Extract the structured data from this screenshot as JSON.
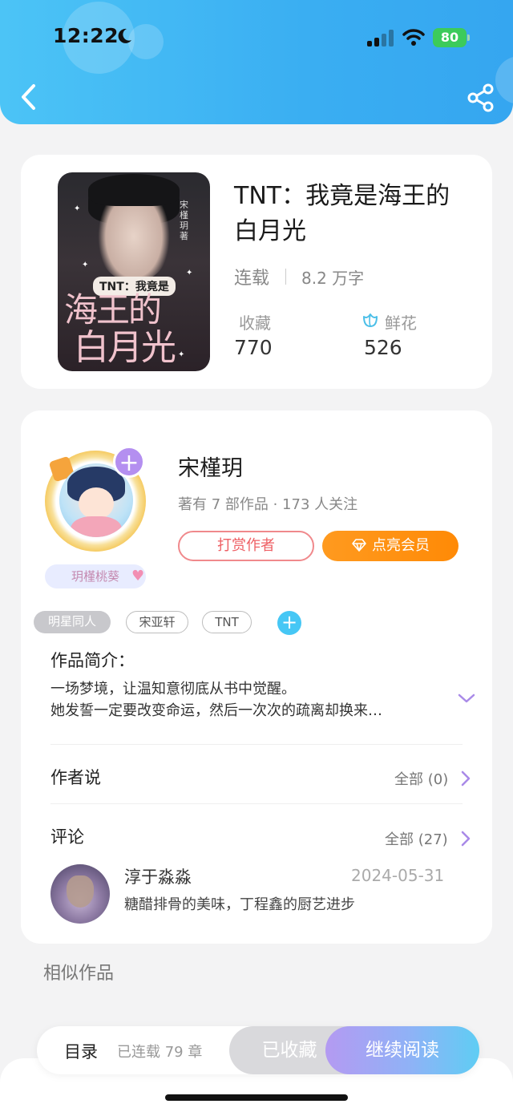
{
  "status_bar": {
    "time": "12:22",
    "battery": "80"
  },
  "book": {
    "title": "TNT：我竟是海王的白月光",
    "status": "连载",
    "words": "8.2 万字",
    "favorites_label": "收藏",
    "favorites_value": "770",
    "flowers_label": "鲜花",
    "flowers_value": "526",
    "cover": {
      "subtitle": "TNT：我竟是",
      "title_line1": "海王的",
      "title_line2": "白月光",
      "author": "宋槿玥著"
    }
  },
  "author": {
    "name": "宋槿玥",
    "meta": "著有 7 部作品 · 173 人关注",
    "fan_tag": "玥槿桃葵",
    "tip_button": "打赏作者",
    "vip_button": "点亮会员"
  },
  "tags": [
    "明星同人",
    "宋亚轩",
    "TNT"
  ],
  "intro": {
    "label": "作品简介：",
    "line1": "一场梦境，让温知意彻底从书中觉醒。",
    "line2": "她发誓一定要改变命运，然后一次次的疏离却换来…"
  },
  "author_says": {
    "label": "作者说",
    "link": "全部 (0)"
  },
  "comments": {
    "label": "评论",
    "link": "全部 (27)",
    "items": [
      {
        "user": "淳于淼淼",
        "date": "2024-05-31",
        "text": "糖醋排骨的美味，丁程鑫的厨艺进步"
      }
    ]
  },
  "similar_label": "相似作品",
  "bottom_bar": {
    "toc": "目录",
    "chapters": "已连载 79 章",
    "saved": "已收藏",
    "continue": "继续阅读"
  }
}
